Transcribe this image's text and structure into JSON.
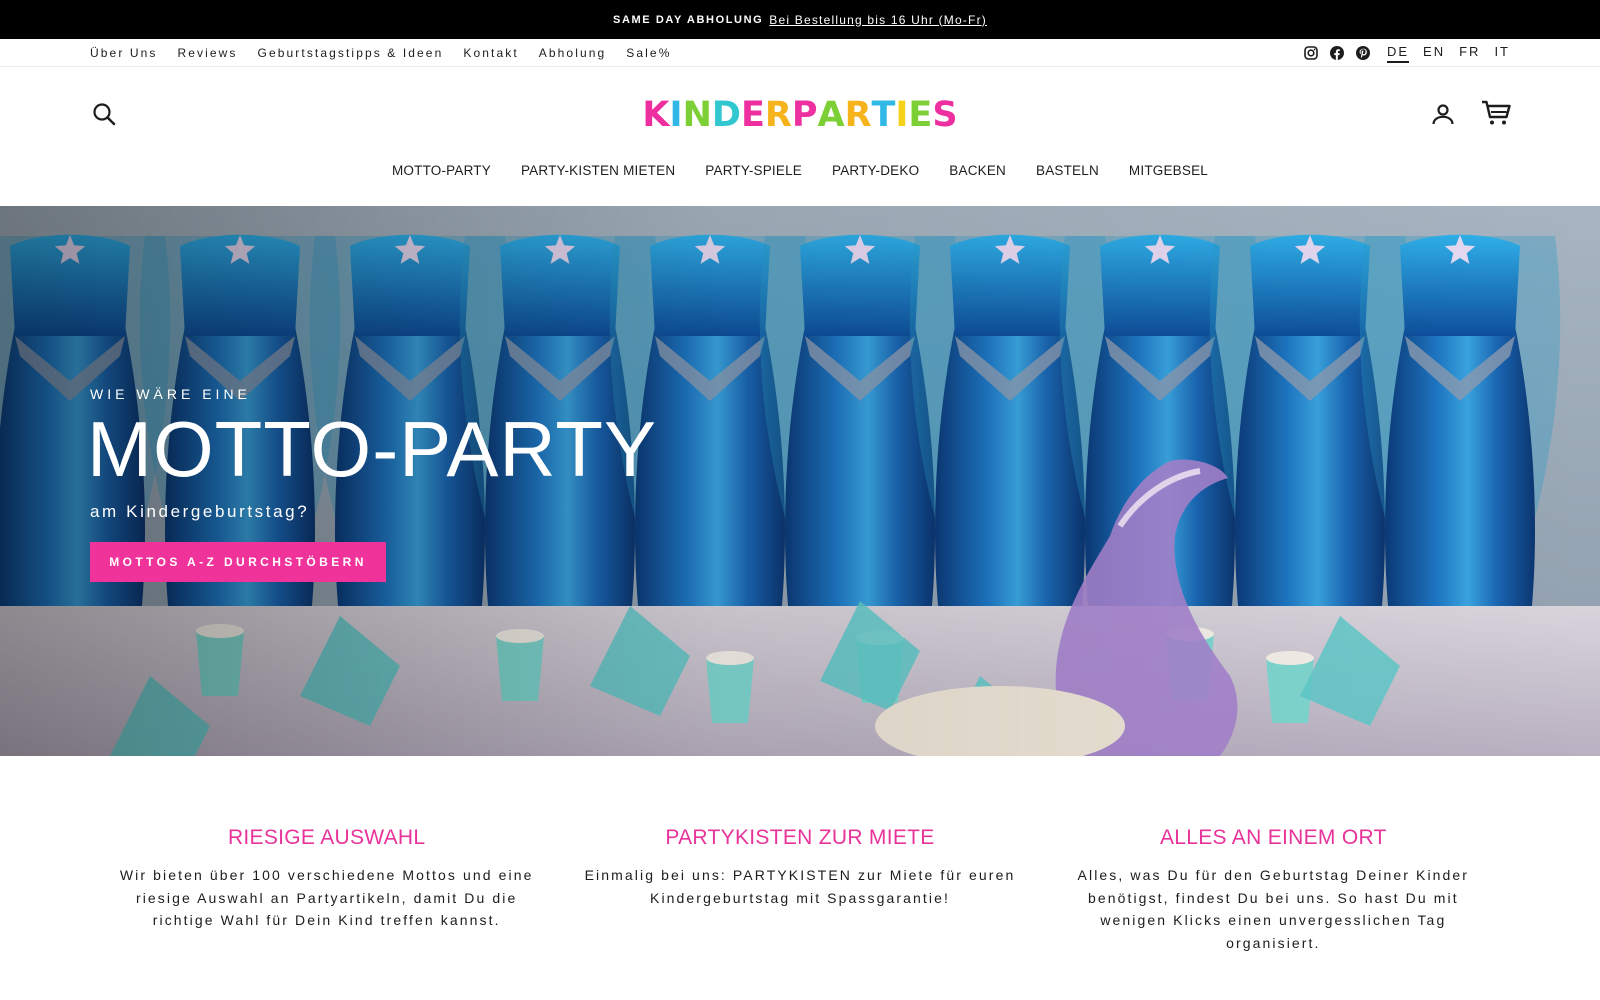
{
  "announcement": {
    "bold": "SAME DAY ABHOLUNG",
    "link": "Bei Bestellung bis 16 Uhr (Mo-Fr)"
  },
  "utility_nav": {
    "items": [
      {
        "label": "Über Uns"
      },
      {
        "label": "Reviews"
      },
      {
        "label": "Geburtstagstipps & Ideen"
      },
      {
        "label": "Kontakt"
      },
      {
        "label": "Abholung"
      },
      {
        "label": "Sale%"
      }
    ],
    "social_icons": [
      "instagram-icon",
      "facebook-icon",
      "pinterest-icon"
    ],
    "languages": [
      {
        "label": "DE",
        "active": true
      },
      {
        "label": "EN",
        "active": false
      },
      {
        "label": "FR",
        "active": false
      },
      {
        "label": "IT",
        "active": false
      }
    ]
  },
  "header": {
    "logo_text": "KINDERPARTIES",
    "logo_colors": [
      "#ee2fa0",
      "#30b7e8",
      "#7ccf34",
      "#31c7d1",
      "#ee2fa0",
      "#f7b31b",
      "#ee2fa0",
      "#7ccf34",
      "#f7b31b",
      "#31b8e7",
      "#f7d21b",
      "#7ccf34",
      "#ee2fa0"
    ],
    "icons": [
      "search-icon",
      "account-icon",
      "cart-icon"
    ]
  },
  "main_nav": {
    "items": [
      {
        "label": "MOTTO-PARTY"
      },
      {
        "label": "PARTY-KISTEN MIETEN"
      },
      {
        "label": "PARTY-SPIELE"
      },
      {
        "label": "PARTY-DEKO"
      },
      {
        "label": "BACKEN"
      },
      {
        "label": "BASTELN"
      },
      {
        "label": "MITGEBSEL"
      }
    ]
  },
  "hero": {
    "kicker": "WIE WÄRE EINE",
    "headline": "MOTTO-PARTY",
    "subline": "am Kindergeburtstag?",
    "cta_label": "MOTTOS A-Z DURCHSTÖBERN",
    "cta_color": "#f0339b"
  },
  "features": [
    {
      "title": "RIESIGE AUSWAHL",
      "text": "Wir bieten über 100 verschiedene Mottos und eine riesige Auswahl an Partyartikeln, damit Du die richtige Wahl für Dein Kind treffen kannst."
    },
    {
      "title": "PARTYKISTEN ZUR MIETE",
      "text": "Einmalig bei uns: PARTYKISTEN zur Miete für euren Kindergeburtstag mit Spassgarantie!"
    },
    {
      "title": "ALLES AN EINEM ORT",
      "text": "Alles, was Du für den Geburtstag Deiner Kinder benötigst, findest Du bei uns. So hast Du mit wenigen Klicks einen unvergesslichen Tag organisiert."
    }
  ],
  "accent_color": "#e7339a"
}
